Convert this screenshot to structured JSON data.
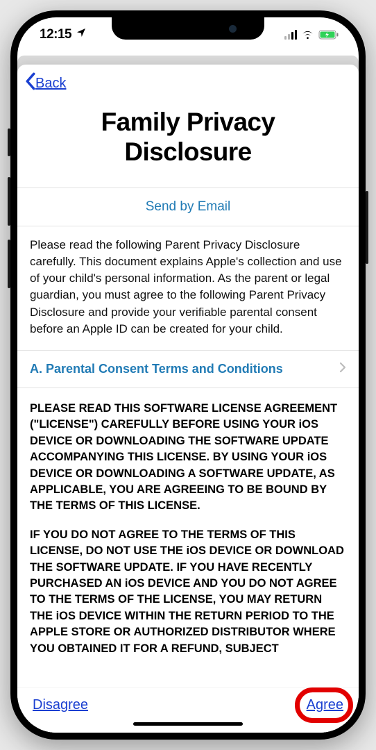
{
  "status": {
    "time": "12:15"
  },
  "nav": {
    "back_label": "Back"
  },
  "title": "Family Privacy Disclosure",
  "send_email": "Send by Email",
  "intro": "Please read the following Parent Privacy Disclosure carefully. This document explains Apple's collection and use of your child's personal information. As the parent or legal guardian, you must agree to the following Parent Privacy Disclosure and provide your verifiable parental consent before an Apple ID can be created for your child.",
  "section_a": "A. Parental Consent Terms and Conditions",
  "license_p1": "PLEASE READ THIS SOFTWARE LICENSE AGREEMENT (\"LICENSE\") CAREFULLY BEFORE USING YOUR iOS DEVICE OR DOWNLOADING THE SOFTWARE UPDATE ACCOMPANYING THIS LICENSE. BY USING YOUR iOS DEVICE OR DOWNLOADING A SOFTWARE UPDATE, AS APPLICABLE, YOU ARE AGREEING TO BE BOUND BY THE TERMS OF THIS LICENSE.",
  "license_p2": "IF YOU DO NOT AGREE TO THE TERMS OF THIS LICENSE, DO NOT USE THE iOS DEVICE OR DOWNLOAD THE SOFTWARE UPDATE. IF YOU HAVE RECENTLY PURCHASED AN iOS DEVICE AND YOU DO NOT AGREE TO THE TERMS OF THE LICENSE, YOU MAY RETURN THE iOS DEVICE WITHIN THE RETURN PERIOD TO THE APPLE STORE OR AUTHORIZED DISTRIBUTOR WHERE YOU OBTAINED IT FOR A REFUND, SUBJECT",
  "footer": {
    "disagree": "Disagree",
    "agree": "Agree"
  }
}
